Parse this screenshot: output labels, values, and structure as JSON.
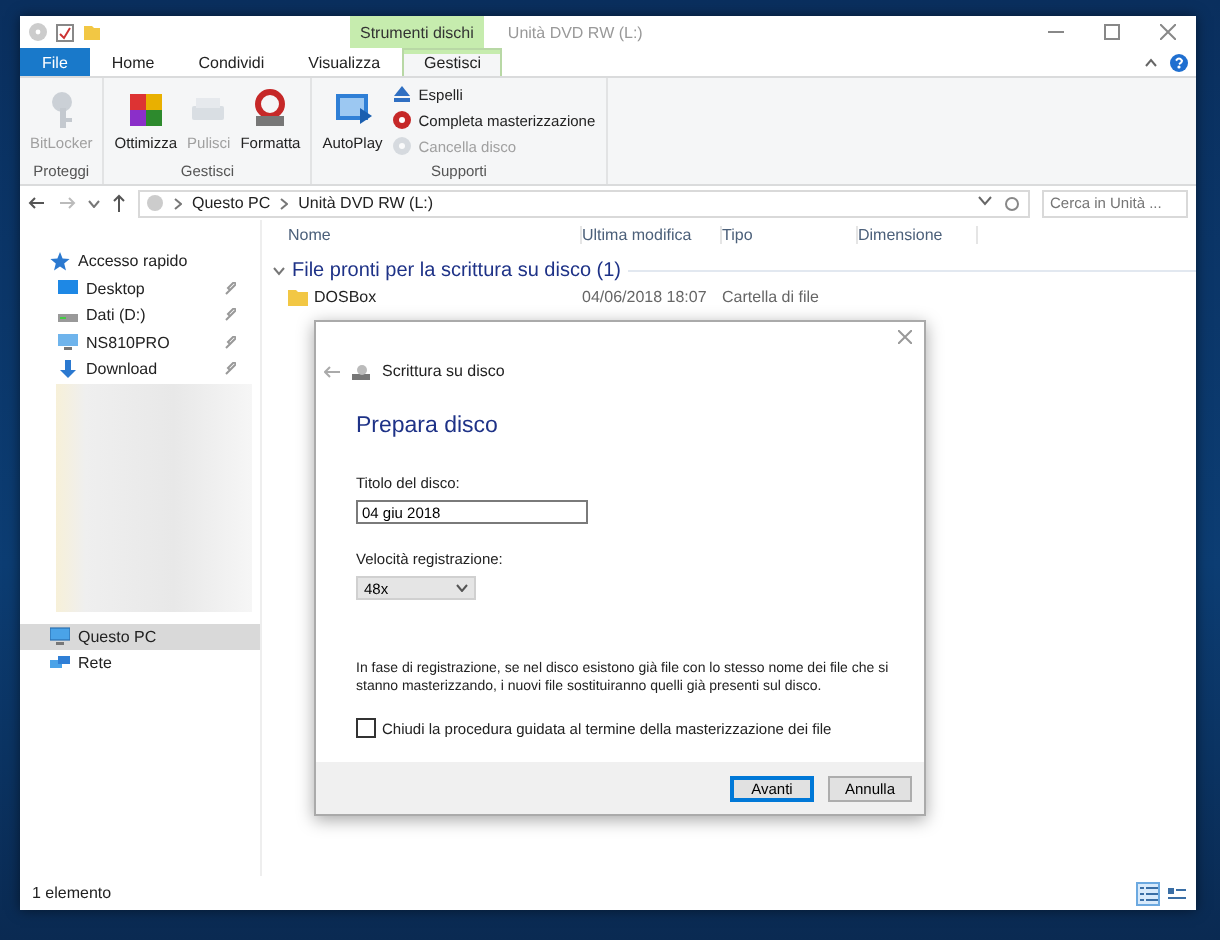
{
  "window": {
    "title": "Unità DVD RW (L:)",
    "context_group": "Strumenti dischi"
  },
  "tabs": [
    {
      "label": "File",
      "kind": "file",
      "selected": false
    },
    {
      "label": "Home",
      "kind": "normal",
      "selected": false
    },
    {
      "label": "Condividi",
      "kind": "normal",
      "selected": false
    },
    {
      "label": "Visualizza",
      "kind": "normal",
      "selected": false
    },
    {
      "label": "Gestisci",
      "kind": "context",
      "selected": true
    }
  ],
  "ribbon_groups": [
    {
      "label": "Proteggi",
      "items": [
        {
          "label": "BitLocker",
          "kind": "large",
          "disabled": true
        }
      ]
    },
    {
      "label": "Gestisci",
      "items": [
        {
          "label": "Ottimizza",
          "kind": "large",
          "disabled": false
        },
        {
          "label": "Pulisci",
          "kind": "large",
          "disabled": true
        },
        {
          "label": "Formatta",
          "kind": "large",
          "disabled": false
        }
      ]
    },
    {
      "label": "Supporti",
      "items": [
        {
          "label": "AutoPlay",
          "kind": "large",
          "disabled": false
        },
        {
          "label": "Espelli",
          "kind": "small",
          "disabled": false
        },
        {
          "label": "Completa masterizzazione",
          "kind": "small",
          "disabled": false
        },
        {
          "label": "Cancella disco",
          "kind": "small",
          "disabled": true
        }
      ]
    }
  ],
  "address": {
    "path": [
      "Questo PC",
      "Unità DVD RW (L:)"
    ],
    "search_placeholder": "Cerca in Unità ..."
  },
  "nav": [
    {
      "label": "Accesso rapido",
      "selected": false,
      "children": [
        {
          "label": "Desktop",
          "pinned": true,
          "selected": false
        },
        {
          "label": "Dati (D:)",
          "pinned": true,
          "selected": false
        },
        {
          "label": "NS810PRO",
          "pinned": true,
          "selected": false
        },
        {
          "label": "Download",
          "pinned": true,
          "selected": false
        }
      ]
    },
    {
      "label": "Questo PC",
      "selected": true
    },
    {
      "label": "Rete",
      "selected": false
    }
  ],
  "columns": [
    "Nome",
    "Ultima modifica",
    "Tipo",
    "Dimensione"
  ],
  "groups": [
    {
      "title": "File pronti per la scrittura su disco (1)",
      "expanded": true,
      "rows": [
        {
          "name": "DOSBox",
          "modified": "04/06/2018 18:07",
          "type": "Cartella di file"
        }
      ]
    }
  ],
  "status_bar": {
    "text": "1 elemento",
    "views": [
      {
        "kind": "details",
        "selected": true
      },
      {
        "kind": "tiles",
        "selected": false
      }
    ]
  },
  "dialog": {
    "header": "Scrittura su disco",
    "heading": "Prepara disco",
    "title_label": "Titolo del disco:",
    "title_value": "04 giu 2018",
    "speed_label": "Velocità registrazione:",
    "speed_value": "48x",
    "note": "In fase di registrazione, se nel disco esistono già file con lo stesso nome dei file che si stanno masterizzando, i nuovi file sostituiranno quelli già presenti sul disco.",
    "close_checkbox": {
      "label": "Chiudi la procedura guidata al termine della masterizzazione dei file",
      "checked": false
    },
    "buttons": [
      {
        "label": "Avanti",
        "default": true
      },
      {
        "label": "Annulla",
        "default": false
      }
    ]
  }
}
